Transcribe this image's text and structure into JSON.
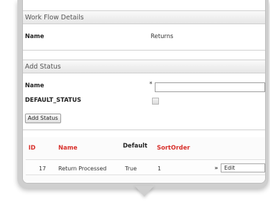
{
  "workflow": {
    "section_title": "Work Flow Details",
    "name_label": "Name",
    "name_value": "Returns"
  },
  "add_status": {
    "section_title": "Add Status",
    "name_label": "Name",
    "required_marker": "*",
    "name_input_value": "",
    "default_status_label": "DEFAULT_STATUS",
    "default_status_checked": false,
    "submit_label": "Add Status"
  },
  "status_table": {
    "columns": [
      "ID",
      "Name",
      "Default",
      "SortOrder"
    ],
    "rows": [
      {
        "id": "17",
        "name": "Return Processed",
        "default": "True",
        "sort_order": "1",
        "arrow": "»",
        "action": "Edit"
      }
    ]
  },
  "colors": {
    "header_link_red": "#d8302b"
  }
}
